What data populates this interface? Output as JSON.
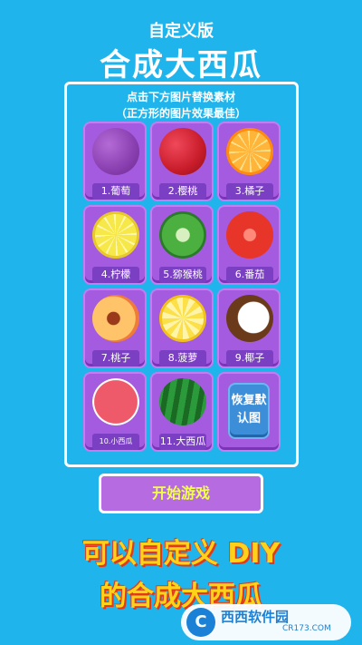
{
  "header": {
    "subtitle": "自定义版",
    "title": "合成大西瓜"
  },
  "hint": {
    "line1": "点击下方图片替换素材",
    "line2": "（正方形的图片效果最佳）"
  },
  "fruits": [
    {
      "label": "1.葡萄",
      "color": "#8a3fb0"
    },
    {
      "label": "2.樱桃",
      "color": "#c81c2a"
    },
    {
      "label": "3.橘子",
      "color": "#ff9c1a"
    },
    {
      "label": "4.柠檬",
      "color": "#f7e84a"
    },
    {
      "label": "5.猕猴桃",
      "color": "#2f9a36"
    },
    {
      "label": "6.番茄",
      "color": "#e8352a"
    },
    {
      "label": "7.桃子",
      "color": "#f7a24a"
    },
    {
      "label": "8.菠萝",
      "color": "#fbe04a"
    },
    {
      "label": "9.椰子",
      "color": "#ffffff"
    },
    {
      "label": "10.小西瓜",
      "color": "#ef5a6a"
    },
    {
      "label": "11.大西瓜",
      "color": "#2a9a3a"
    }
  ],
  "restore_button": {
    "label": "恢复默认图"
  },
  "start_button": {
    "label": "开始游戏"
  },
  "caption": {
    "line1": "可以自定义 DIY",
    "line2": "的合成大西瓜"
  },
  "watermark": {
    "text": "西西软件园",
    "url": "CR173.COM",
    "logo": "C"
  }
}
